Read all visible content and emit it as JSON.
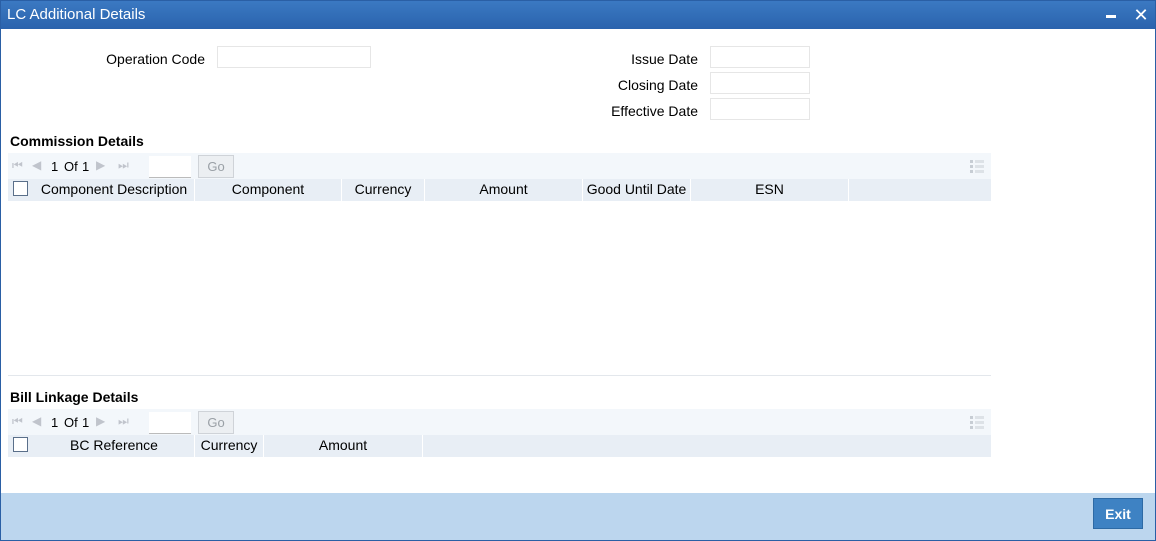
{
  "window": {
    "title": "LC Additional Details"
  },
  "form": {
    "operation_code_label": "Operation Code",
    "operation_code_value": "",
    "issue_date_label": "Issue Date",
    "issue_date_value": "",
    "closing_date_label": "Closing Date",
    "closing_date_value": "",
    "effective_date_label": "Effective Date",
    "effective_date_value": ""
  },
  "commission": {
    "title": "Commission Details",
    "pager": {
      "current": "1",
      "of_label": "Of",
      "total": "1",
      "go_label": "Go"
    },
    "columns": [
      "Component Description",
      "Component",
      "Currency",
      "Amount",
      "Good Until Date",
      "ESN"
    ],
    "rows": []
  },
  "bill_linkage": {
    "title": "Bill Linkage Details",
    "pager": {
      "current": "1",
      "of_label": "Of",
      "total": "1",
      "go_label": "Go"
    },
    "columns": [
      "BC Reference",
      "Currency",
      "Amount"
    ],
    "rows": []
  },
  "footer": {
    "exit_label": "Exit"
  },
  "colors": {
    "titlebar": "#2a63ad",
    "footer": "#bcd6ee",
    "exit_button": "#3e82c3",
    "grid_header": "#e8eef5"
  }
}
